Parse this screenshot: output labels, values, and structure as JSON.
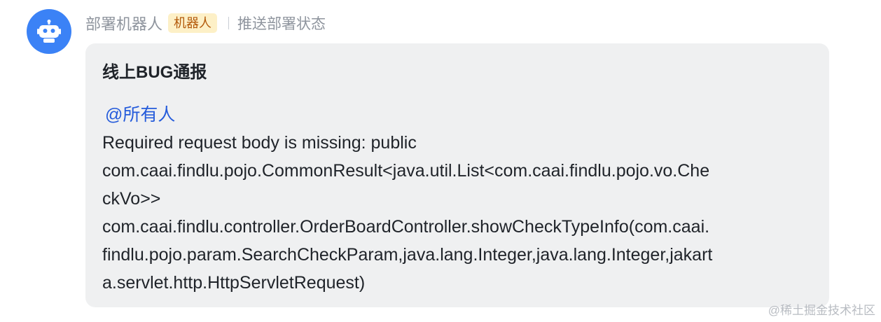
{
  "sender": {
    "name": "部署机器人",
    "badge": "机器人",
    "subtitle": "推送部署状态"
  },
  "card": {
    "title": "线上BUG通报",
    "mention": "@所有人",
    "lines": [
      "Required request body is missing: public",
      "com.caai.findlu.pojo.CommonResult<java.util.List<com.caai.findlu.pojo.vo.Che",
      "ckVo>>",
      "com.caai.findlu.controller.OrderBoardController.showCheckTypeInfo(com.caai.",
      "findlu.pojo.param.SearchCheckParam,java.lang.Integer,java.lang.Integer,jakart",
      "a.servlet.http.HttpServletRequest)"
    ]
  },
  "watermark": "@稀土掘金技术社区",
  "colors": {
    "avatar": "#3b82f6",
    "mention": "#245bdb",
    "card_bg": "#eff0f1",
    "badge_bg": "#fdf0c7",
    "badge_text": "#b3590a"
  },
  "icons": {
    "avatar": "robot-icon"
  }
}
